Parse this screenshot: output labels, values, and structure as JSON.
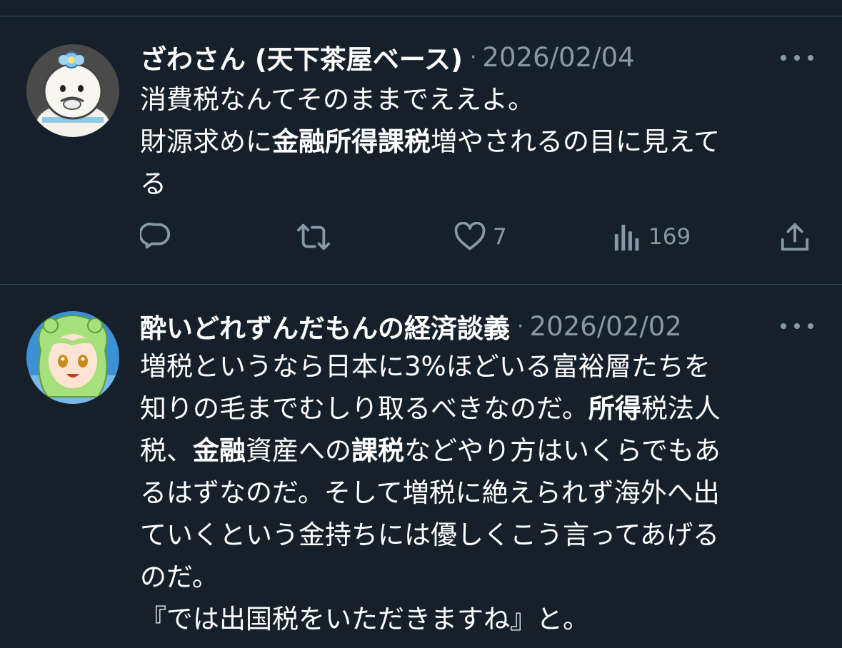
{
  "colors": {
    "background": "#15202b",
    "text": "#ffffff",
    "secondary": "#8899a6",
    "divider": "#38444d"
  },
  "tweets": [
    {
      "author": "ざわさん (天下茶屋ベース)",
      "separator": "·",
      "date": "2026/02/04",
      "avatar": "cartoon-character-avatar",
      "lines": [
        [
          {
            "t": "消費税なんてそのままでええよ。",
            "b": false
          }
        ],
        [
          {
            "t": "財源求めに",
            "b": false
          },
          {
            "t": "金融所得課税",
            "b": true
          },
          {
            "t": "増やされるの目に見えて",
            "b": false
          }
        ],
        [
          {
            "t": "る",
            "b": false
          }
        ]
      ],
      "stats": {
        "replies": "",
        "retweets": "",
        "likes": "7",
        "views": "169"
      }
    },
    {
      "author": "酔いどれずんだもんの経済談義",
      "separator": "·",
      "date": "2026/02/02",
      "avatar": "anime-character-avatar",
      "lines": [
        [
          {
            "t": "増税というなら日本に3%ほどいる富裕層たちを",
            "b": false
          }
        ],
        [
          {
            "t": "知りの毛までむしり取るべきなのだ。",
            "b": false
          },
          {
            "t": "所得",
            "b": true
          },
          {
            "t": "税法人",
            "b": false
          }
        ],
        [
          {
            "t": "税、",
            "b": false
          },
          {
            "t": "金融",
            "b": true
          },
          {
            "t": "資産への",
            "b": false
          },
          {
            "t": "課税",
            "b": true
          },
          {
            "t": "などやり方はいくらでもあ",
            "b": false
          }
        ],
        [
          {
            "t": "るはずなのだ。そして増税に絶えられず海外へ出",
            "b": false
          }
        ],
        [
          {
            "t": "ていくという金持ちには優しくこう言ってあげる",
            "b": false
          }
        ],
        [
          {
            "t": "のだ。",
            "b": false
          }
        ],
        [
          {
            "t": "『では出国税をいただきますね』と。",
            "b": false
          }
        ]
      ]
    }
  ]
}
